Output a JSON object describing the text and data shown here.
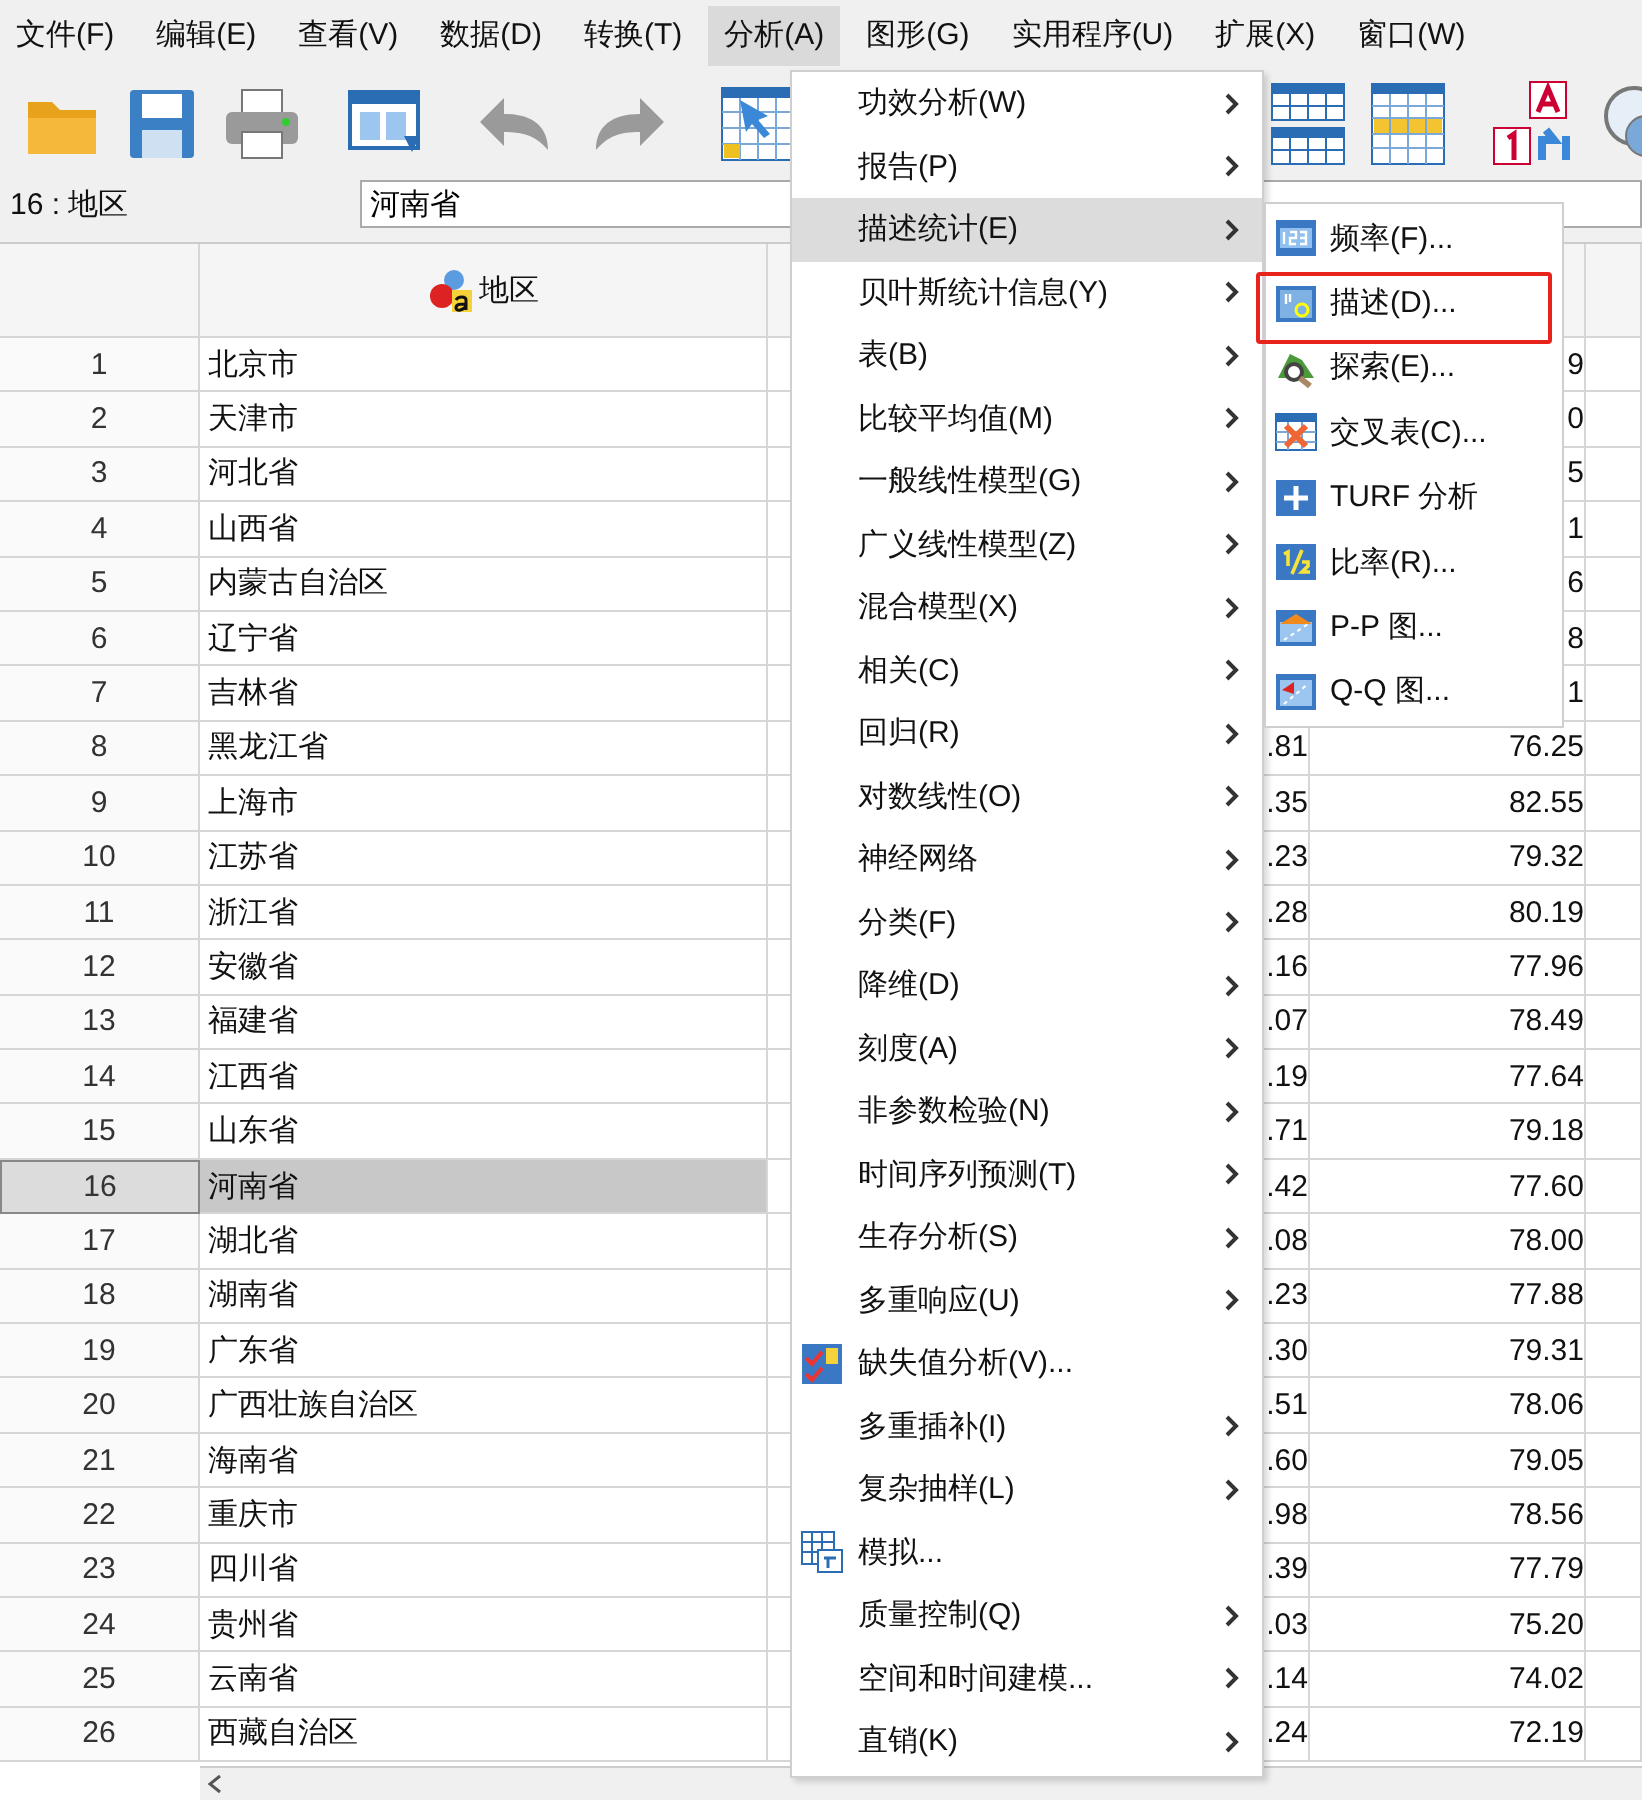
{
  "menubar": [
    {
      "label": "文件(F)",
      "selected": false
    },
    {
      "label": "编辑(E)",
      "selected": false
    },
    {
      "label": "查看(V)",
      "selected": false
    },
    {
      "label": "数据(D)",
      "selected": false
    },
    {
      "label": "转换(T)",
      "selected": false
    },
    {
      "label": "分析(A)",
      "selected": true
    },
    {
      "label": "图形(G)",
      "selected": false
    },
    {
      "label": "实用程序(U)",
      "selected": false
    },
    {
      "label": "扩展(X)",
      "selected": false
    },
    {
      "label": "窗口(W)",
      "selected": false
    }
  ],
  "cell_editor": {
    "cell_ref": "16 : 地区",
    "value": "河南省"
  },
  "grid": {
    "column_header": "地区",
    "rows": [
      {
        "number": "1",
        "region": "北京市",
        "column_4": "9",
        "selected": false
      },
      {
        "number": "2",
        "region": "天津市",
        "column_4": "0",
        "selected": false
      },
      {
        "number": "3",
        "region": "河北省",
        "column_4": "5",
        "selected": false
      },
      {
        "number": "4",
        "region": "山西省",
        "column_4": "1",
        "selected": false
      },
      {
        "number": "5",
        "region": "内蒙古自治区",
        "column_4": "6",
        "selected": false
      },
      {
        "number": "6",
        "region": "辽宁省",
        "column_4": "8",
        "selected": false
      },
      {
        "number": "7",
        "region": "吉林省",
        "column_4": "1",
        "selected": false
      },
      {
        "number": "8",
        "region": "黑龙江省",
        "column_3": ".81",
        "column_4": "76.25",
        "selected": false
      },
      {
        "number": "9",
        "region": "上海市",
        "column_3": ".35",
        "column_4": "82.55",
        "selected": false
      },
      {
        "number": "10",
        "region": "江苏省",
        "column_3": ".23",
        "column_4": "79.32",
        "selected": false
      },
      {
        "number": "11",
        "region": "浙江省",
        "column_3": ".28",
        "column_4": "80.19",
        "selected": false
      },
      {
        "number": "12",
        "region": "安徽省",
        "column_3": ".16",
        "column_4": "77.96",
        "selected": false
      },
      {
        "number": "13",
        "region": "福建省",
        "column_3": ".07",
        "column_4": "78.49",
        "selected": false
      },
      {
        "number": "14",
        "region": "江西省",
        "column_3": ".19",
        "column_4": "77.64",
        "selected": false
      },
      {
        "number": "15",
        "region": "山东省",
        "column_3": ".71",
        "column_4": "79.18",
        "selected": false
      },
      {
        "number": "16",
        "region": "河南省",
        "column_3": ".42",
        "column_4": "77.60",
        "selected": true
      },
      {
        "number": "17",
        "region": "湖北省",
        "column_3": ".08",
        "column_4": "78.00",
        "selected": false
      },
      {
        "number": "18",
        "region": "湖南省",
        "column_3": ".23",
        "column_4": "77.88",
        "selected": false
      },
      {
        "number": "19",
        "region": "广东省",
        "column_3": ".30",
        "column_4": "79.31",
        "selected": false
      },
      {
        "number": "20",
        "region": "广西壮族自治区",
        "column_3": ".51",
        "column_4": "78.06",
        "selected": false
      },
      {
        "number": "21",
        "region": "海南省",
        "column_3": ".60",
        "column_4": "79.05",
        "selected": false
      },
      {
        "number": "22",
        "region": "重庆市",
        "column_3": ".98",
        "column_4": "78.56",
        "selected": false
      },
      {
        "number": "23",
        "region": "四川省",
        "column_3": ".39",
        "column_4": "77.79",
        "selected": false
      },
      {
        "number": "24",
        "region": "贵州省",
        "column_3": ".03",
        "column_4": "75.20",
        "selected": false
      },
      {
        "number": "25",
        "region": "云南省",
        "column_3": ".14",
        "column_4": "74.02",
        "selected": false
      },
      {
        "number": "26",
        "region": "西藏自治区",
        "column_3": ".24",
        "column_4": "72.19",
        "selected": false
      }
    ]
  },
  "analyze_menu": [
    {
      "label": "功效分析(W)",
      "kind": "submenu",
      "selected": false
    },
    {
      "label": "报告(P)",
      "kind": "submenu",
      "selected": false
    },
    {
      "label": "描述统计(E)",
      "kind": "submenu",
      "selected": true
    },
    {
      "label": "贝叶斯统计信息(Y)",
      "kind": "submenu",
      "selected": false
    },
    {
      "label": "表(B)",
      "kind": "submenu",
      "selected": false
    },
    {
      "label": "比较平均值(M)",
      "kind": "submenu",
      "selected": false
    },
    {
      "label": "一般线性模型(G)",
      "kind": "submenu",
      "selected": false
    },
    {
      "label": "广义线性模型(Z)",
      "kind": "submenu",
      "selected": false
    },
    {
      "label": "混合模型(X)",
      "kind": "submenu",
      "selected": false
    },
    {
      "label": "相关(C)",
      "kind": "submenu",
      "selected": false
    },
    {
      "label": "回归(R)",
      "kind": "submenu",
      "selected": false
    },
    {
      "label": "对数线性(O)",
      "kind": "submenu",
      "selected": false
    },
    {
      "label": "神经网络",
      "kind": "submenu",
      "selected": false
    },
    {
      "label": "分类(F)",
      "kind": "submenu",
      "selected": false
    },
    {
      "label": "降维(D)",
      "kind": "submenu",
      "selected": false
    },
    {
      "label": "刻度(A)",
      "kind": "submenu",
      "selected": false
    },
    {
      "label": "非参数检验(N)",
      "kind": "submenu",
      "selected": false
    },
    {
      "label": "时间序列预测(T)",
      "kind": "submenu",
      "selected": false
    },
    {
      "label": "生存分析(S)",
      "kind": "submenu",
      "selected": false
    },
    {
      "label": "多重响应(U)",
      "kind": "submenu",
      "selected": false
    },
    {
      "label": "缺失值分析(V)...",
      "kind": "dialog",
      "selected": false
    },
    {
      "label": "多重插补(I)",
      "kind": "submenu",
      "selected": false
    },
    {
      "label": "复杂抽样(L)",
      "kind": "submenu",
      "selected": false
    },
    {
      "label": "模拟...",
      "kind": "dialog",
      "selected": false
    },
    {
      "label": "质量控制(Q)",
      "kind": "submenu",
      "selected": false
    },
    {
      "label": "空间和时间建模...",
      "kind": "submenu",
      "selected": false
    },
    {
      "label": "直销(K)",
      "kind": "submenu",
      "selected": false
    }
  ],
  "descriptive_submenu": [
    {
      "label": "频率(F)...",
      "highlighted": false
    },
    {
      "label": "描述(D)...",
      "highlighted": true
    },
    {
      "label": "探索(E)...",
      "highlighted": false
    },
    {
      "label": "交叉表(C)...",
      "highlighted": false
    },
    {
      "label": "TURF 分析",
      "highlighted": false
    },
    {
      "label": "比率(R)...",
      "highlighted": false
    },
    {
      "label": "P-P 图...",
      "highlighted": false
    },
    {
      "label": "Q-Q 图...",
      "highlighted": false
    }
  ]
}
